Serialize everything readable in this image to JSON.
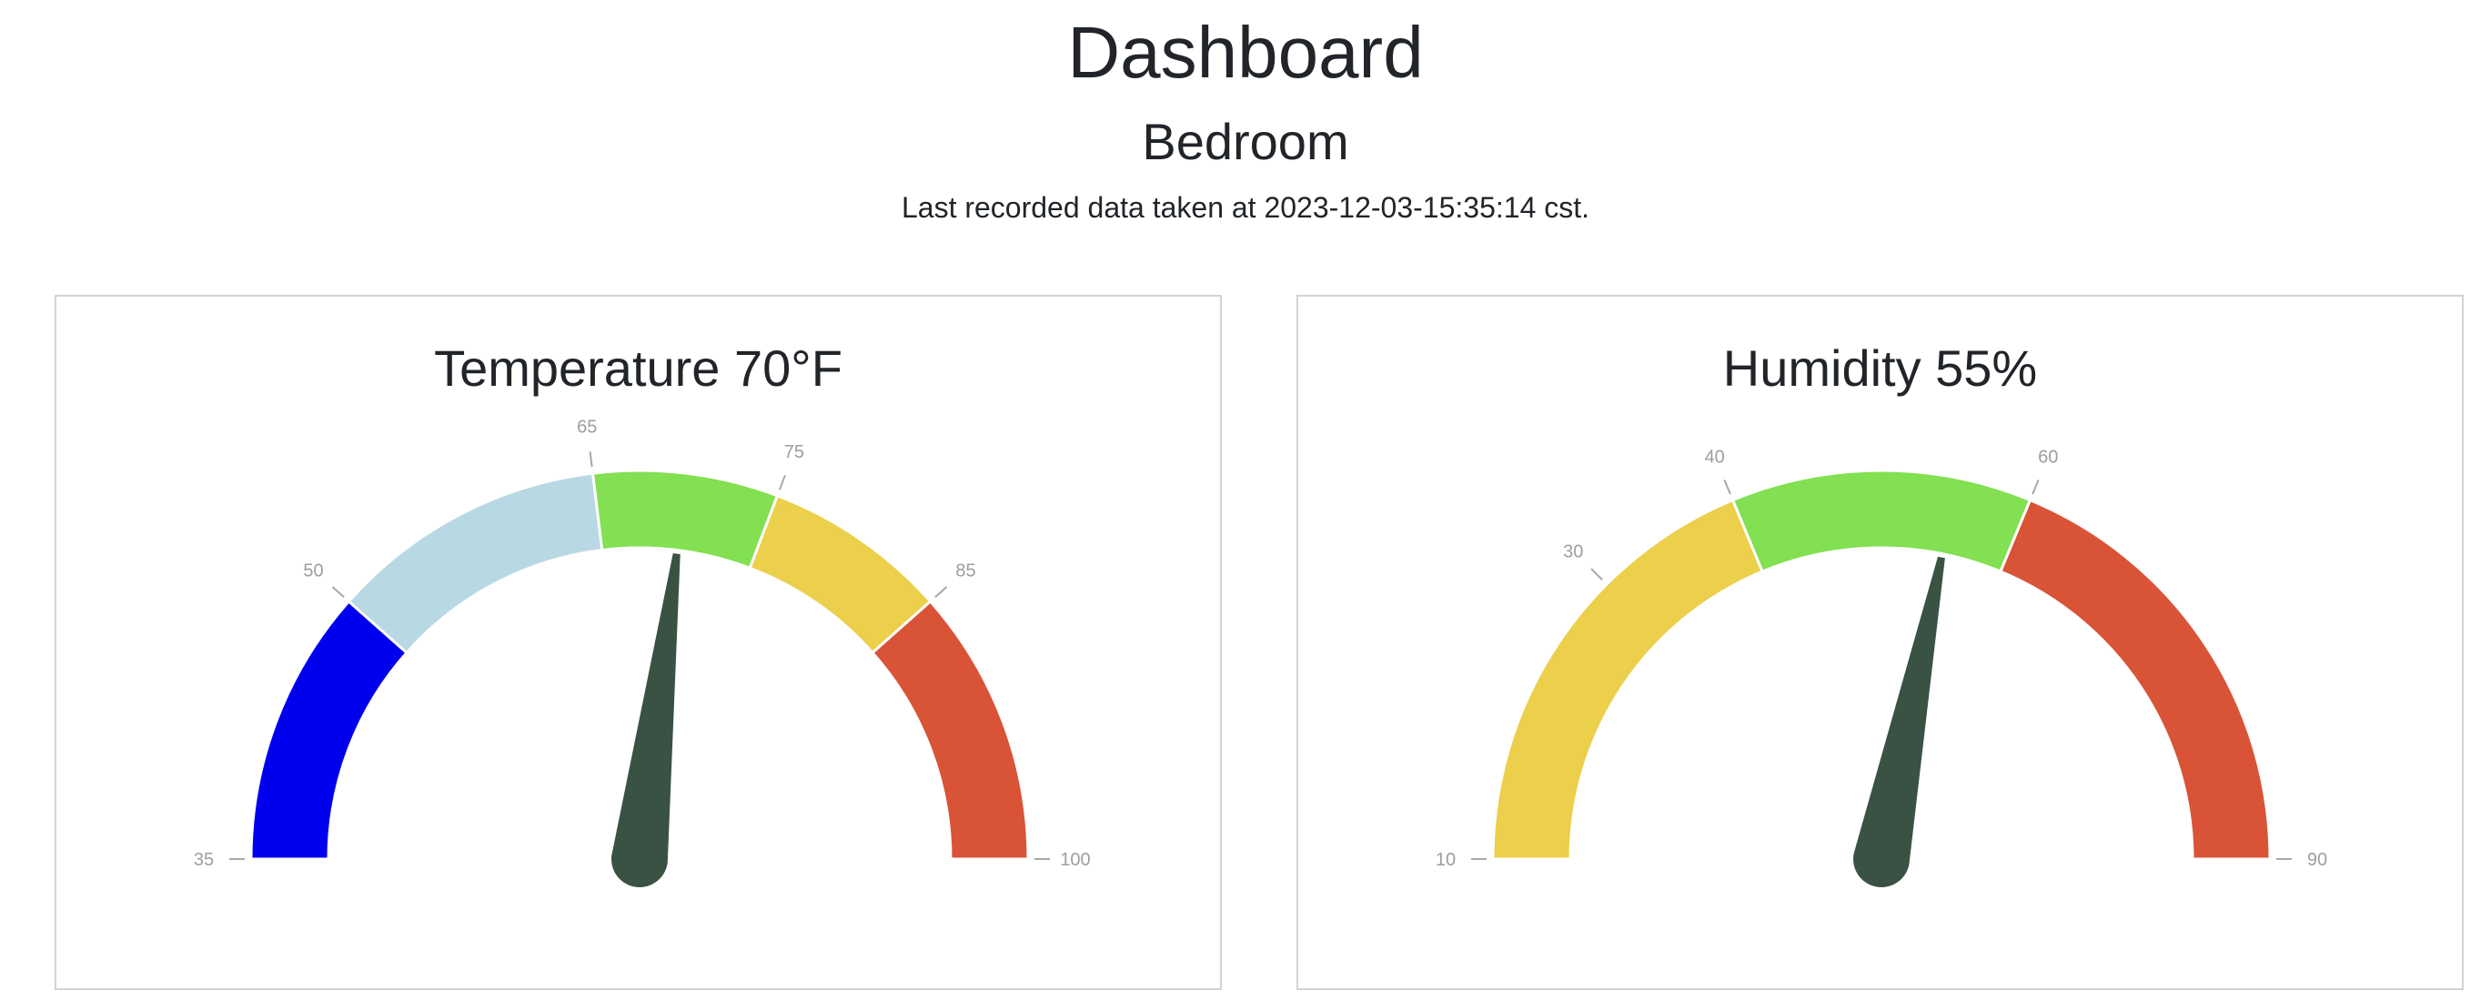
{
  "page": {
    "title": "Dashboard",
    "room": "Bedroom",
    "last_recorded": "Last recorded data taken at 2023-12-03-15:35:14 cst."
  },
  "chart_data": [
    {
      "type": "gauge",
      "title": "Temperature 70°F",
      "min": 35,
      "max": 100,
      "value": 70,
      "ticks": [
        35,
        50,
        65,
        75,
        85,
        100
      ],
      "segments": [
        {
          "from": 35,
          "to": 50,
          "color": "#0000ee"
        },
        {
          "from": 50,
          "to": 65,
          "color": "#b8d8e3"
        },
        {
          "from": 65,
          "to": 75,
          "color": "#82e052"
        },
        {
          "from": 75,
          "to": 85,
          "color": "#eccf4a"
        },
        {
          "from": 85,
          "to": 100,
          "color": "#d95337"
        }
      ],
      "needle_color": "#3a5244"
    },
    {
      "type": "gauge",
      "title": "Humidity 55%",
      "min": 10,
      "max": 90,
      "value": 55,
      "ticks": [
        10,
        30,
        40,
        60,
        90
      ],
      "segments": [
        {
          "from": 10,
          "to": 40,
          "color": "#eccf4a"
        },
        {
          "from": 40,
          "to": 60,
          "color": "#82e052"
        },
        {
          "from": 60,
          "to": 90,
          "color": "#d95337"
        }
      ],
      "needle_color": "#3a5244"
    }
  ]
}
